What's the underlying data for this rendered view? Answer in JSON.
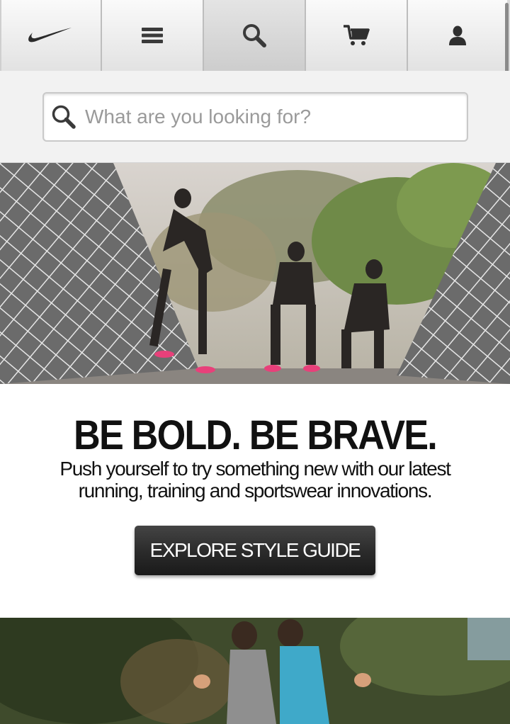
{
  "nav": {
    "items": [
      {
        "name": "nike-swoosh-logo"
      },
      {
        "name": "menu-icon"
      },
      {
        "name": "search-icon"
      },
      {
        "name": "cart-icon"
      },
      {
        "name": "user-icon"
      }
    ],
    "active_index": 2
  },
  "search": {
    "placeholder": "What are you looking for?",
    "value": ""
  },
  "promo": {
    "title": "BE BOLD. BE BRAVE.",
    "text": "Push yourself to try something new with our latest running, training and sportswear innovations.",
    "button_label": "EXPLORE STYLE GUIDE"
  },
  "images": {
    "hero1": "women-athletes-on-rope-bridge-photo",
    "hero2": "women-running-outdoors-photo"
  },
  "colors": {
    "button_bg": "#2a2a2a",
    "nav_bg": "#ededed",
    "search_bg": "#f2f2f2"
  }
}
